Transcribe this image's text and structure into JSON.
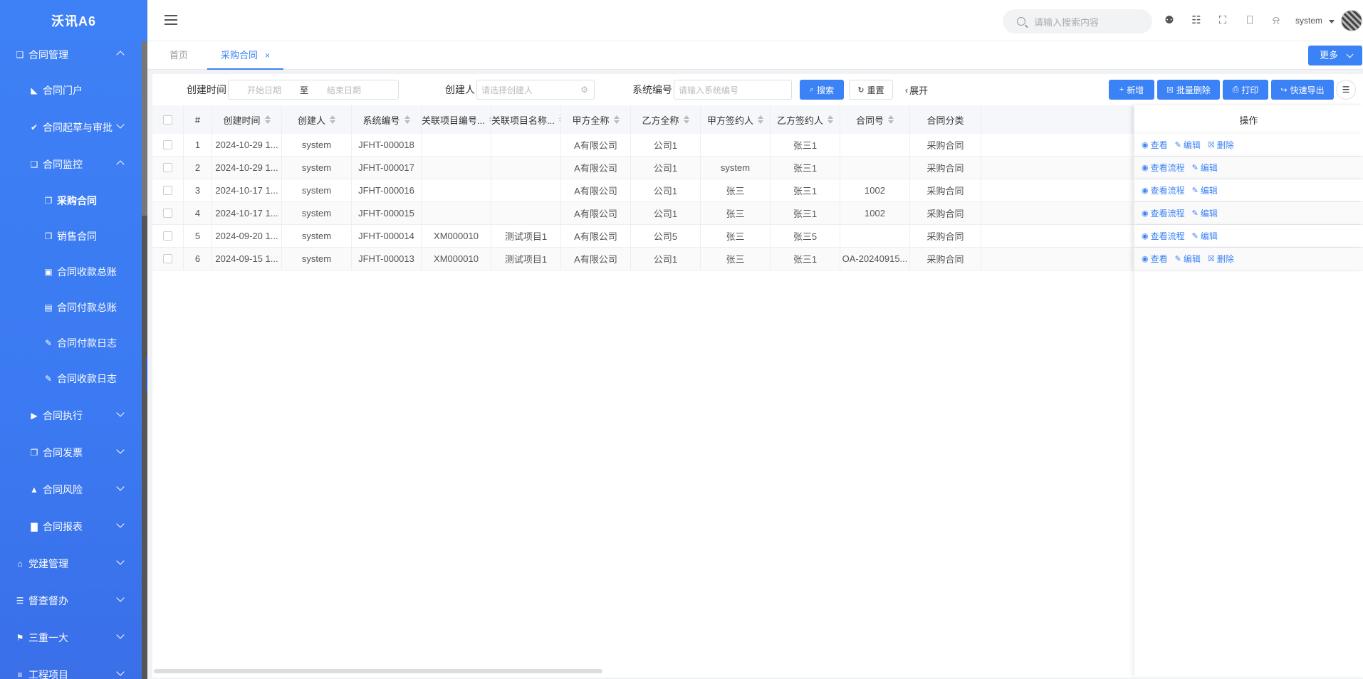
{
  "sidebar": {
    "logo": "沃讯A6",
    "items": [
      {
        "label": "合同管理",
        "icon": "file-icon"
      },
      {
        "label": "合同门户",
        "icon": "chart-area-icon"
      },
      {
        "label": "合同起草与审批",
        "icon": "check-icon"
      },
      {
        "label": "合同监控",
        "icon": "file-icon"
      },
      {
        "label": "采购合同",
        "icon": "file-pdf-icon"
      },
      {
        "label": "销售合同",
        "icon": "file-word-icon"
      },
      {
        "label": "合同收款总账",
        "icon": "calendar-plus-icon"
      },
      {
        "label": "合同付款总账",
        "icon": "calendar-minus-icon"
      },
      {
        "label": "合同付款日志",
        "icon": "brush-icon"
      },
      {
        "label": "合同收款日志",
        "icon": "pencil-icon"
      },
      {
        "label": "合同执行",
        "icon": "play-icon"
      },
      {
        "label": "合同发票",
        "icon": "invoice-icon"
      },
      {
        "label": "合同风险",
        "icon": "bell-icon"
      },
      {
        "label": "合同报表",
        "icon": "bar-chart-icon"
      },
      {
        "label": "党建管理",
        "icon": "bank-icon"
      },
      {
        "label": "督查督办",
        "icon": "list-icon"
      },
      {
        "label": "三重一大",
        "icon": "flag-icon"
      },
      {
        "label": "工程项目",
        "icon": "bars-icon"
      }
    ]
  },
  "header": {
    "search_placeholder": "请输入搜索内容",
    "user": "system",
    "tools": [
      "shirt-icon",
      "translate-icon",
      "fullscreen-icon",
      "lock-icon",
      "bell-icon"
    ]
  },
  "tabs": {
    "home": "首页",
    "active": "采购合同",
    "close": "×",
    "more": "更多"
  },
  "filters": {
    "created_label": "创建时间",
    "start_placeholder": "开始日期",
    "to": "至",
    "end_placeholder": "结束日期",
    "creator_label": "创建人",
    "creator_placeholder": "请选择创建人",
    "sysno_label": "系统编号",
    "sysno_placeholder": "请输入系统编号",
    "search": "搜索",
    "reset": "重置",
    "expand": "展开"
  },
  "actions": {
    "add": "新增",
    "batch_delete": "批量删除",
    "print": "打印",
    "export": "快速导出"
  },
  "table": {
    "columns": [
      "#",
      "创建时间",
      "创建人",
      "系统编号",
      "关联项目编号...",
      "关联项目名称...",
      "甲方全称",
      "乙方全称",
      "甲方签约人",
      "乙方签约人",
      "合同号",
      "合同分类",
      "操作"
    ],
    "rows": [
      {
        "idx": "1",
        "time": "2024-10-29 1...",
        "creator": "system",
        "sysno": "JFHT-000018",
        "projno": "",
        "projname": "",
        "partyA": "A有限公司",
        "partyB": "公司1",
        "signerA": "",
        "signerB": "张三1",
        "contractNo": "",
        "category": "采购合同",
        "ops": [
          "查看",
          "编辑",
          "删除"
        ]
      },
      {
        "idx": "2",
        "time": "2024-10-29 1...",
        "creator": "system",
        "sysno": "JFHT-000017",
        "projno": "",
        "projname": "",
        "partyA": "A有限公司",
        "partyB": "公司1",
        "signerA": "system",
        "signerB": "张三1",
        "contractNo": "",
        "category": "采购合同",
        "ops": [
          "查看流程",
          "编辑"
        ]
      },
      {
        "idx": "3",
        "time": "2024-10-17 1...",
        "creator": "system",
        "sysno": "JFHT-000016",
        "projno": "",
        "projname": "",
        "partyA": "A有限公司",
        "partyB": "公司1",
        "signerA": "张三",
        "signerB": "张三1",
        "contractNo": "1002",
        "category": "采购合同",
        "ops": [
          "查看流程",
          "编辑"
        ]
      },
      {
        "idx": "4",
        "time": "2024-10-17 1...",
        "creator": "system",
        "sysno": "JFHT-000015",
        "projno": "",
        "projname": "",
        "partyA": "A有限公司",
        "partyB": "公司1",
        "signerA": "张三",
        "signerB": "张三1",
        "contractNo": "1002",
        "category": "采购合同",
        "ops": [
          "查看流程",
          "编辑"
        ]
      },
      {
        "idx": "5",
        "time": "2024-09-20 1...",
        "creator": "system",
        "sysno": "JFHT-000014",
        "projno": "XM000010",
        "projname": "测试项目1",
        "partyA": "A有限公司",
        "partyB": "公司5",
        "signerA": "张三",
        "signerB": "张三5",
        "contractNo": "",
        "category": "采购合同",
        "ops": [
          "查看流程",
          "编辑"
        ]
      },
      {
        "idx": "6",
        "time": "2024-09-15 1...",
        "creator": "system",
        "sysno": "JFHT-000013",
        "projno": "XM000010",
        "projname": "测试项目1",
        "partyA": "A有限公司",
        "partyB": "公司1",
        "signerA": "张三",
        "signerB": "张三1",
        "contractNo": "OA-20240915...",
        "category": "采购合同",
        "ops": [
          "查看",
          "编辑",
          "删除"
        ]
      }
    ]
  }
}
